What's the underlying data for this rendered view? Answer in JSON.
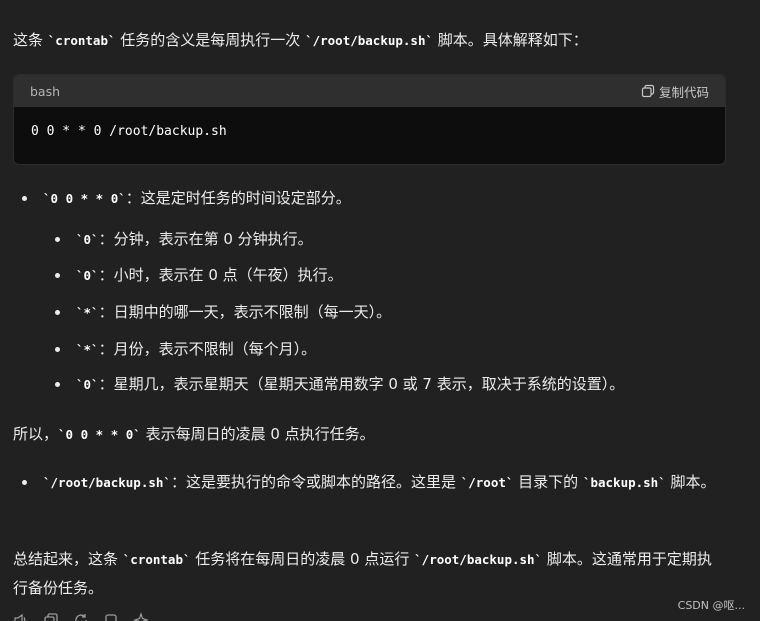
{
  "intro": {
    "t1": "这条 ",
    "c1": "`crontab`",
    "t2": " 任务的含义是每周执行一次 ",
    "c2": "`/root/backup.sh`",
    "t3": " 脚本。具体解释如下："
  },
  "codeblock": {
    "language": "bash",
    "copy_label": "复制代码",
    "code": "0 0 * * 0 /root/backup.sh"
  },
  "list1": {
    "code": "`0 0 * * 0`",
    "text": "：这是定时任务的时间设定部分。",
    "sub": [
      {
        "code": "`0`",
        "text": "：分钟，表示在第 0 分钟执行。"
      },
      {
        "code": "`0`",
        "text": "：小时，表示在 0 点（午夜）执行。"
      },
      {
        "code": "`*`",
        "text": "：日期中的哪一天，表示不限制（每一天）。"
      },
      {
        "code": "`*`",
        "text": "：月份，表示不限制（每个月）。"
      },
      {
        "code": "`0`",
        "text": "：星期几，表示星期天（星期天通常用数字 0 或 7 表示，取决于系统的设置）。"
      }
    ]
  },
  "summary1": {
    "t1": "所以，",
    "c1": "`0 0 * * 0`",
    "t2": " 表示每周日的凌晨 0 点执行任务。"
  },
  "path_item": {
    "c1": "`/root/backup.sh`",
    "t1": "：这是要执行的命令或脚本的路径。这里是 ",
    "c2": "`/root`",
    "t2": " 目录下的 ",
    "c3": "`backup.sh`",
    "t3": " 脚本。"
  },
  "summary2": {
    "t1": "总结起来，这条 ",
    "c1": "`crontab`",
    "t2": " 任务将在每周日的凌晨 0 点运行 ",
    "c2": "`/root/backup.sh`",
    "t3": " 脚本。这通常用于定期执行备份任务。"
  },
  "watermark": "CSDN @呕...",
  "icons": [
    "speaker-icon",
    "copy-message-icon",
    "regenerate-icon",
    "edit-icon",
    "sparkle-icon"
  ]
}
